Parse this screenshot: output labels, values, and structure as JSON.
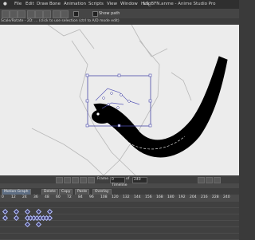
{
  "menubar": {
    "items": [
      "File",
      "Edit",
      "Draw",
      "Bone",
      "Animation",
      "Scripts",
      "View",
      "Window",
      "Help"
    ],
    "window_title": "LS_BFN.anme - Anime Studio Pro"
  },
  "toolbar": {
    "show_path_label": "Show path",
    "show_curve_label": ""
  },
  "status": {
    "text": "Scale/Rotate - 2D: ... (click to use selection (ctrl to A/D mode edit)"
  },
  "canvas_bar": {
    "frame_label": "Frame",
    "frame_value": "0",
    "of_label": "of",
    "end_value": "240"
  },
  "timeline": {
    "title": "Timeline",
    "tabs": [
      "Motion Graph",
      "Delete",
      "Copy",
      "Paste",
      "Overlay"
    ],
    "active_tab": 0,
    "ruler_ticks": [
      "0",
      "12",
      "24",
      "36",
      "48",
      "60",
      "72",
      "84",
      "96",
      "108",
      "120",
      "132",
      "144",
      "156",
      "168",
      "180",
      "192",
      "204",
      "216",
      "228",
      "240"
    ]
  },
  "colors": {
    "canvas_bg": "#ececec",
    "stroke": "#000000",
    "selection": "#4a4aa8",
    "keyframe": "#b9c4ff"
  }
}
